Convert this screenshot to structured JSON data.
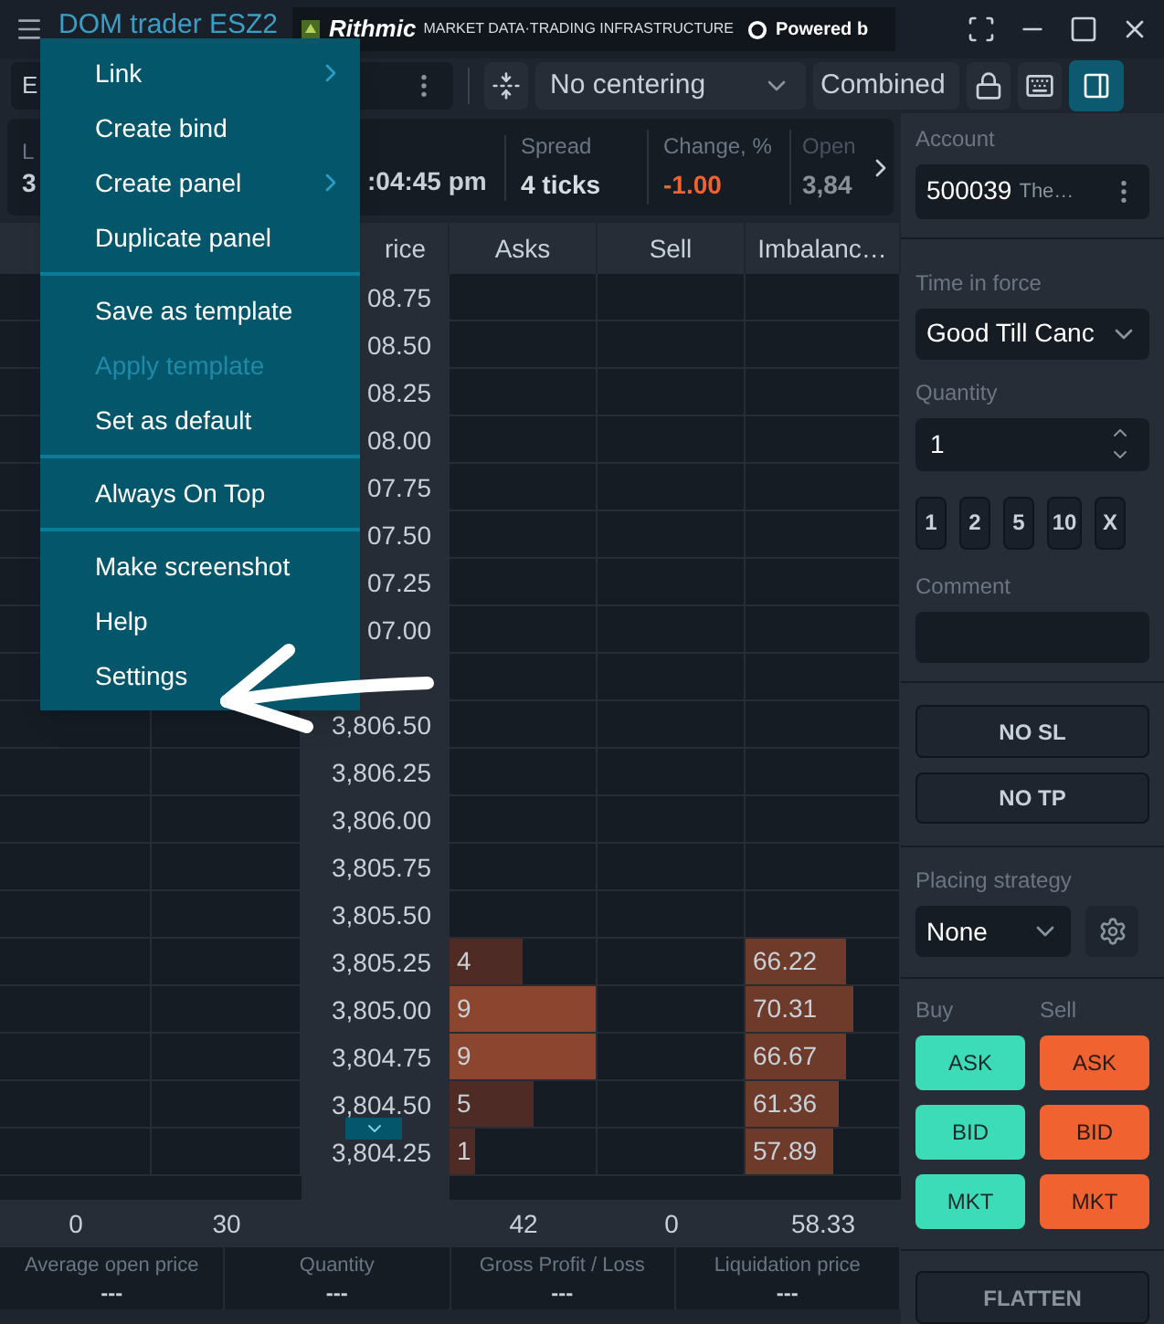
{
  "window": {
    "title": "DOM trader ESZ2",
    "brand": "Rithmic",
    "tagline": "MARKET DATA·TRADING INFRASTRUCTURE",
    "powered": "Powered b"
  },
  "toolbar": {
    "instrument": "E",
    "centering": "No centering",
    "mode": "Combined",
    "side_panel_on": true
  },
  "info": {
    "first": {
      "label": "L",
      "value": "3"
    },
    "time": ":04:45 pm",
    "cells": [
      {
        "label": "Spread",
        "value": "4 ticks",
        "kind": "plain"
      },
      {
        "label": "Change, %",
        "value": "-1.00",
        "kind": "negative"
      },
      {
        "label": "Open",
        "value": "3,84",
        "kind": "faded"
      }
    ]
  },
  "grid": {
    "headers": [
      "rice",
      "Asks",
      "Sell",
      "Imbalanc…"
    ],
    "rows": [
      {
        "price": "08.75"
      },
      {
        "price": "08.50"
      },
      {
        "price": "08.25"
      },
      {
        "price": "08.00"
      },
      {
        "price": "07.75"
      },
      {
        "price": "07.50"
      },
      {
        "price": "07.25"
      },
      {
        "price": "07.00"
      },
      {},
      {
        "price": "3,806.50"
      },
      {
        "price": "3,806.25"
      },
      {
        "price": "3,806.00"
      },
      {
        "price": "3,805.75"
      },
      {
        "price": "3,805.50"
      },
      {
        "price": "3,805.25",
        "asks": {
          "value": "4",
          "level": 0.5
        },
        "imbalance": {
          "value": "66.22",
          "level": 0.66
        }
      },
      {
        "price": "3,805.00",
        "asks": {
          "value": "9",
          "level": 1.0
        },
        "imbalance": {
          "value": "70.31",
          "level": 0.7
        }
      },
      {
        "price": "3,804.75",
        "asks": {
          "value": "9",
          "level": 1.0
        },
        "imbalance": {
          "value": "66.67",
          "level": 0.66
        }
      },
      {
        "price": "3,804.50",
        "asks": {
          "value": "5",
          "level": 0.58
        },
        "imbalance": {
          "value": "61.36",
          "level": 0.61
        }
      },
      {
        "price": "3,804.25",
        "asks": {
          "value": "1",
          "level": 0.18
        },
        "imbalance": {
          "value": "57.89",
          "level": 0.57
        }
      }
    ],
    "totals": {
      "col1": "0",
      "col2": "30",
      "asks": "42",
      "sell": "0",
      "imbalance": "58.33"
    }
  },
  "stats": [
    {
      "label": "Average open price",
      "value": "---"
    },
    {
      "label": "Quantity",
      "value": "---"
    },
    {
      "label": "Gross Profit / Loss",
      "value": "---"
    },
    {
      "label": "Liquidation price",
      "value": "---"
    }
  ],
  "order": {
    "account_label": "Account",
    "account_number": "500039",
    "account_name": "The…",
    "tif_label": "Time in force",
    "tif": "Good Till Canc",
    "quantity_label": "Quantity",
    "quantity": "1",
    "quick": [
      "1",
      "2",
      "5",
      "10",
      "X"
    ],
    "comment_label": "Comment",
    "sl": "NO SL",
    "tp": "NO TP",
    "strategy_label": "Placing strategy",
    "strategy": "None",
    "buy_label": "Buy",
    "sell_label": "Sell",
    "buy": [
      "ASK",
      "BID",
      "MKT"
    ],
    "sell": [
      "ASK",
      "BID",
      "MKT"
    ],
    "flatten": "FLATTEN"
  },
  "menu": {
    "sections": [
      [
        {
          "label": "Link",
          "submenu": true,
          "disabled": false
        },
        {
          "label": "Create bind",
          "submenu": false,
          "disabled": false
        },
        {
          "label": "Create panel",
          "submenu": true,
          "disabled": false
        },
        {
          "label": "Duplicate panel",
          "submenu": false,
          "disabled": false
        }
      ],
      [
        {
          "label": "Save as template",
          "submenu": false,
          "disabled": false
        },
        {
          "label": "Apply template",
          "submenu": false,
          "disabled": true
        },
        {
          "label": "Set as default",
          "submenu": false,
          "disabled": false
        }
      ],
      [
        {
          "label": "Always On Top",
          "submenu": false,
          "disabled": false
        }
      ],
      [
        {
          "label": "Make screenshot",
          "submenu": false,
          "disabled": false
        },
        {
          "label": "Help",
          "submenu": false,
          "disabled": false
        },
        {
          "label": "Settings",
          "submenu": false,
          "disabled": false
        }
      ]
    ]
  }
}
